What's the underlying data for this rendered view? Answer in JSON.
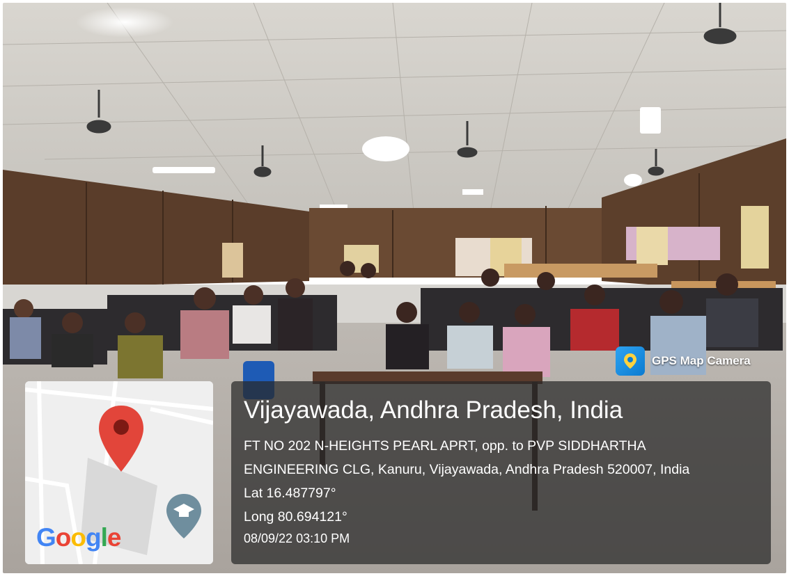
{
  "app": {
    "badge_label": "GPS Map Camera",
    "map_logo": "Google"
  },
  "location": {
    "city": "Vijayawada, Andhra Pradesh, India",
    "address_line1": "FT NO 202 N-HEIGHTS PEARL APRT, opp. to PVP SIDDHARTHA",
    "address_line2": "ENGINEERING CLG, Kanuru, Vijayawada, Andhra Pradesh 520007, India",
    "latitude": "Lat 16.487797°",
    "longitude": "Long 80.694121°",
    "datetime": "08/09/22 03:10 PM"
  },
  "icons": [
    "map-pin-icon",
    "graduation-cap-icon",
    "gps-camera-icon"
  ],
  "colors": {
    "pin": "#e2453a",
    "overlay": "#2b2b2b",
    "google_blue": "#4285F4",
    "google_red": "#EA4335",
    "google_yellow": "#FBBC05",
    "google_green": "#34A853"
  }
}
